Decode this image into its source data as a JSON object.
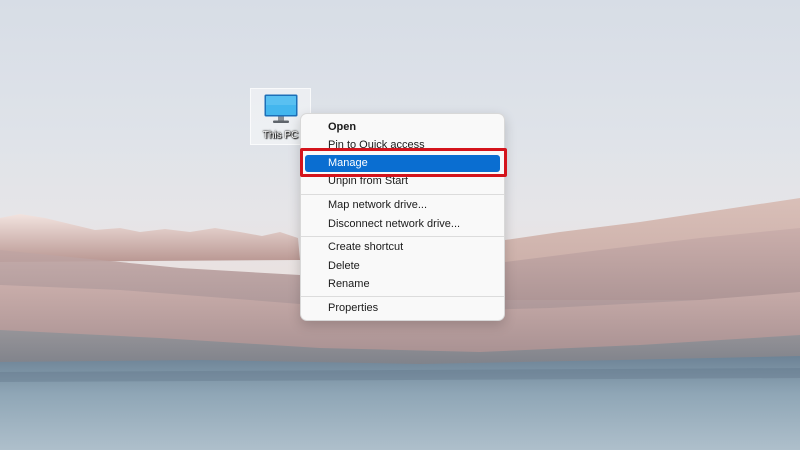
{
  "desktop": {
    "icon": {
      "label": "This PC",
      "icon_name": "monitor-icon"
    }
  },
  "context_menu": {
    "groups": [
      [
        {
          "label": "Open",
          "bold": true
        },
        {
          "label": "Pin to Quick access"
        },
        {
          "label": "Manage",
          "selected": true
        },
        {
          "label": "Unpin from Start"
        }
      ],
      [
        {
          "label": "Map network drive..."
        },
        {
          "label": "Disconnect network drive..."
        }
      ],
      [
        {
          "label": "Create shortcut"
        },
        {
          "label": "Delete"
        },
        {
          "label": "Rename"
        }
      ],
      [
        {
          "label": "Properties"
        }
      ]
    ]
  },
  "colors": {
    "selection": "#0a6ed1",
    "highlight_border": "#d4141c"
  }
}
